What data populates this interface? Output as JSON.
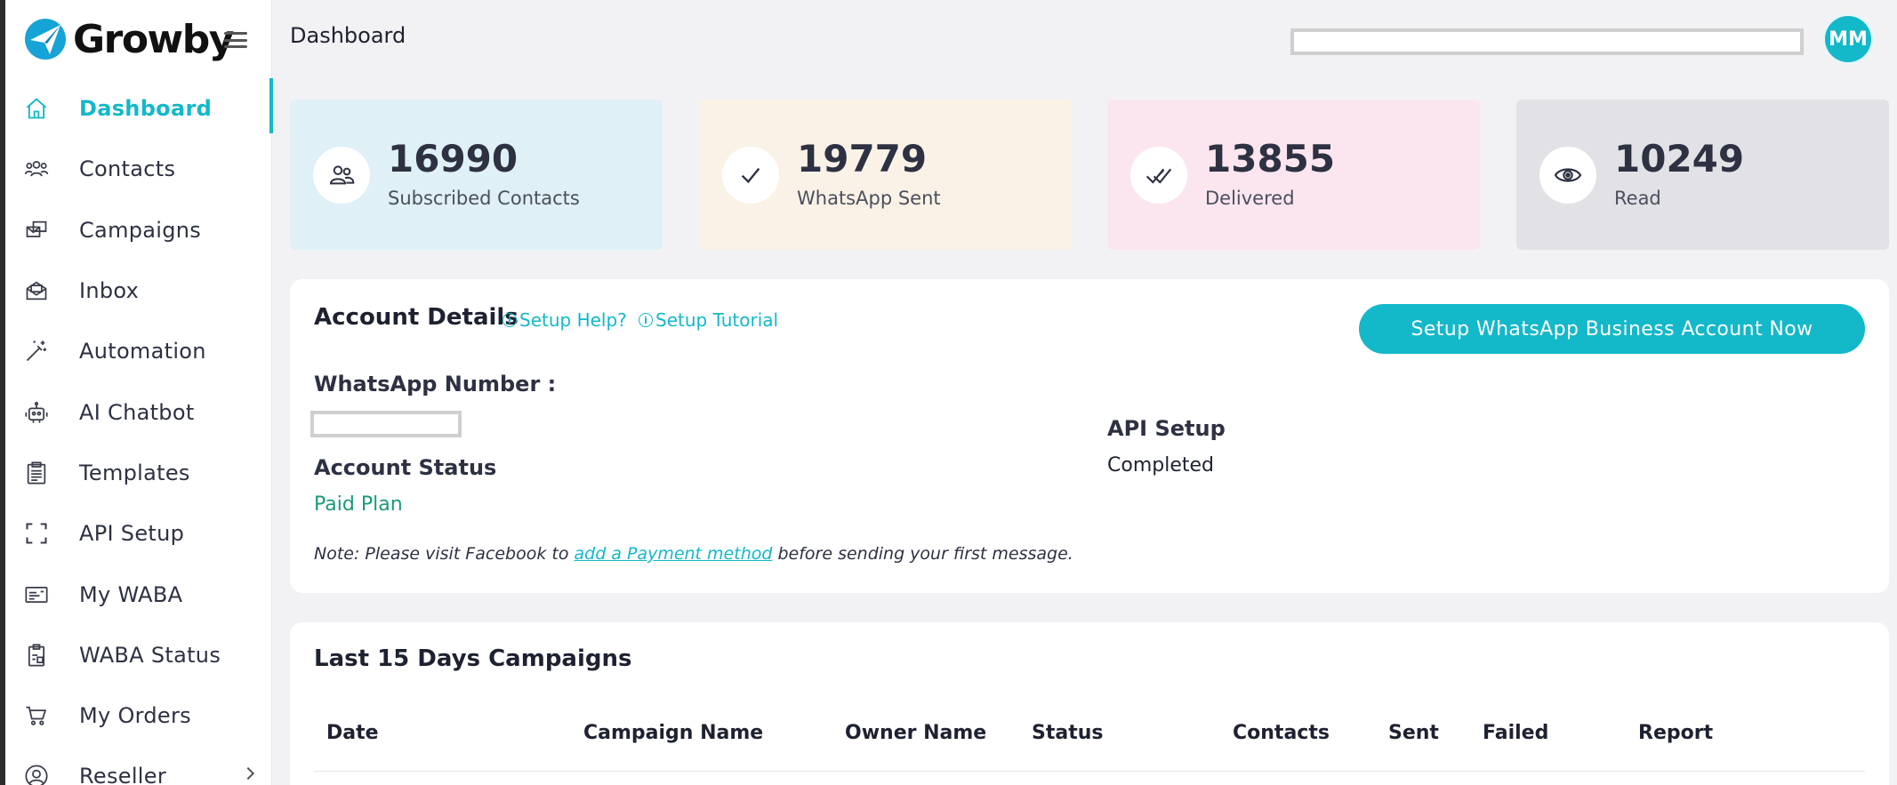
{
  "brand": {
    "name": "Growby"
  },
  "sidebar": {
    "items": [
      {
        "label": "Dashboard",
        "icon": "home-icon"
      },
      {
        "label": "Contacts",
        "icon": "users-icon"
      },
      {
        "label": "Campaigns",
        "icon": "campaigns-icon"
      },
      {
        "label": "Inbox",
        "icon": "inbox-icon"
      },
      {
        "label": "Automation",
        "icon": "magic-wand-icon"
      },
      {
        "label": "AI Chatbot",
        "icon": "robot-icon"
      },
      {
        "label": "Templates",
        "icon": "clipboard-icon"
      },
      {
        "label": "API Setup",
        "icon": "scan-frame-icon"
      },
      {
        "label": "My WABA",
        "icon": "id-card-icon"
      },
      {
        "label": "WABA Status",
        "icon": "clipboard-check-icon"
      },
      {
        "label": "My Orders",
        "icon": "cart-icon"
      },
      {
        "label": "Reseller",
        "icon": "user-circle-icon"
      }
    ],
    "active_index": 0
  },
  "header": {
    "title": "Dashboard",
    "search_value": "",
    "avatar_initials": "MM"
  },
  "stats": [
    {
      "value": "16990",
      "label": "Subscribed Contacts",
      "icon": "users-icon",
      "bg": "#dff0f7"
    },
    {
      "value": "19779",
      "label": "WhatsApp Sent",
      "icon": "check-icon",
      "bg": "#faf2e6"
    },
    {
      "value": "13855",
      "label": "Delivered",
      "icon": "double-check-icon",
      "bg": "#fbe6ef"
    },
    {
      "value": "10249",
      "label": "Read",
      "icon": "eye-icon",
      "bg": "#e2e2e6"
    }
  ],
  "account": {
    "title": "Account Details",
    "help_link": "Setup Help?",
    "tutorial_link": "Setup Tutorial",
    "cta_button": "Setup WhatsApp Business Account Now",
    "whatsapp_number_label": "WhatsApp Number :",
    "whatsapp_number_value": "",
    "status_label": "Account Status",
    "status_value": "Paid Plan",
    "api_setup_label": "API Setup",
    "api_setup_value": "Completed",
    "note_prefix": "Note: Please visit Facebook to ",
    "note_link": "add a Payment method",
    "note_suffix": " before sending your first message."
  },
  "campaigns": {
    "title": "Last 15 Days Campaigns",
    "columns": [
      "Date",
      "Campaign Name",
      "Owner Name",
      "Status",
      "Contacts",
      "Sent",
      "Failed",
      "Report"
    ]
  },
  "colors": {
    "accent": "#13b8c9",
    "status_green": "#1a9b78",
    "text_dark": "#1e2130"
  }
}
